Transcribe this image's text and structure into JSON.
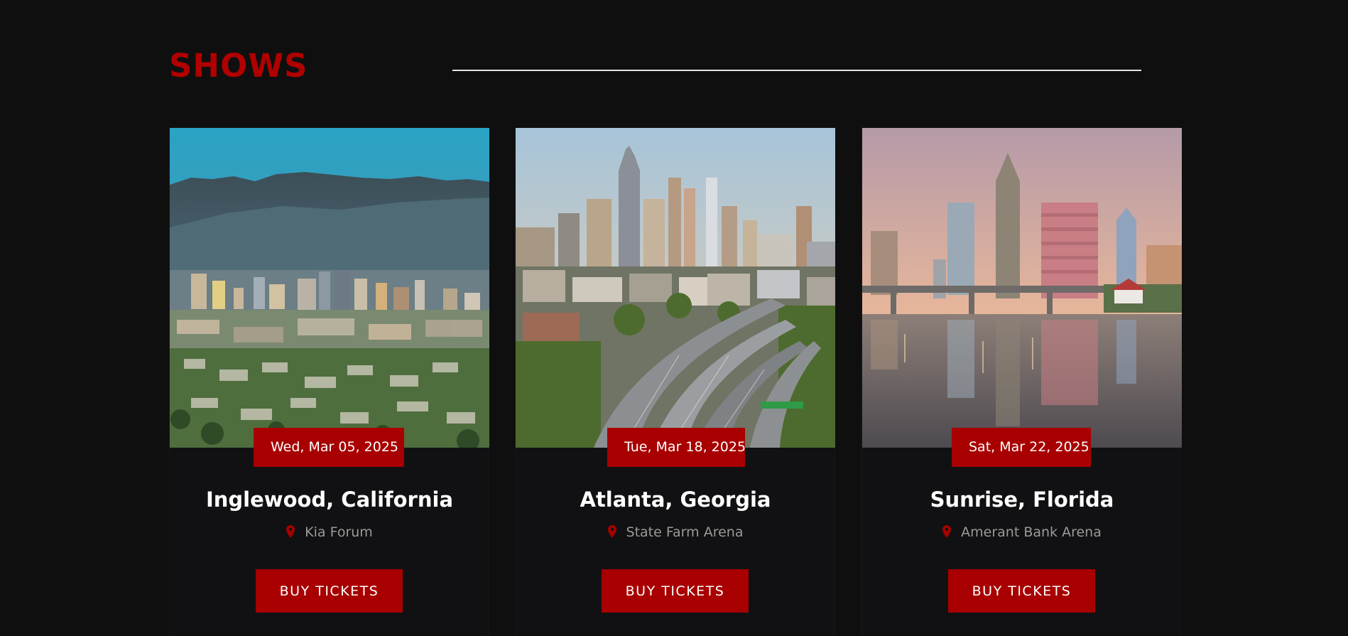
{
  "section": {
    "title": "SHOWS"
  },
  "colors": {
    "background": "#0f0f10",
    "accent": "#a80000",
    "title_red": "#b00000",
    "venue_gray": "#9a9a9a"
  },
  "shows": [
    {
      "date": "Wed, Mar 05, 2025",
      "city": "Inglewood, California",
      "venue": "Kia Forum",
      "button_label": "BUY TICKETS",
      "image": "city-skyline-photo-bay-area"
    },
    {
      "date": "Tue, Mar 18, 2025",
      "city": "Atlanta, Georgia",
      "venue": "State Farm Arena",
      "button_label": "BUY TICKETS",
      "image": "city-skyline-photo-atlanta-highway"
    },
    {
      "date": "Sat, Mar 22, 2025",
      "city": "Sunrise, Florida",
      "venue": "Amerant Bank Arena",
      "button_label": "BUY TICKETS",
      "image": "city-skyline-photo-waterfront"
    }
  ],
  "icons": {
    "venue": "map-pin-icon"
  }
}
